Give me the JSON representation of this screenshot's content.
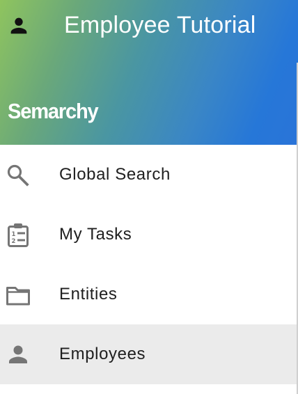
{
  "app": {
    "title": "Employee Tutorial",
    "brand": "Semarchy",
    "header_gradient": [
      "#8fc45e",
      "#2677d8"
    ],
    "header_user_icon": "person-icon"
  },
  "menu": {
    "items": [
      {
        "label": "Global Search",
        "icon": "search-icon",
        "active": false
      },
      {
        "label": "My Tasks",
        "icon": "clipboard-list-icon",
        "active": false
      },
      {
        "label": "Entities",
        "icon": "folder-icon",
        "active": false
      },
      {
        "label": "Employees",
        "icon": "person-icon",
        "active": true
      }
    ],
    "icon_color": "#757575",
    "active_background": "#ebebeb"
  }
}
